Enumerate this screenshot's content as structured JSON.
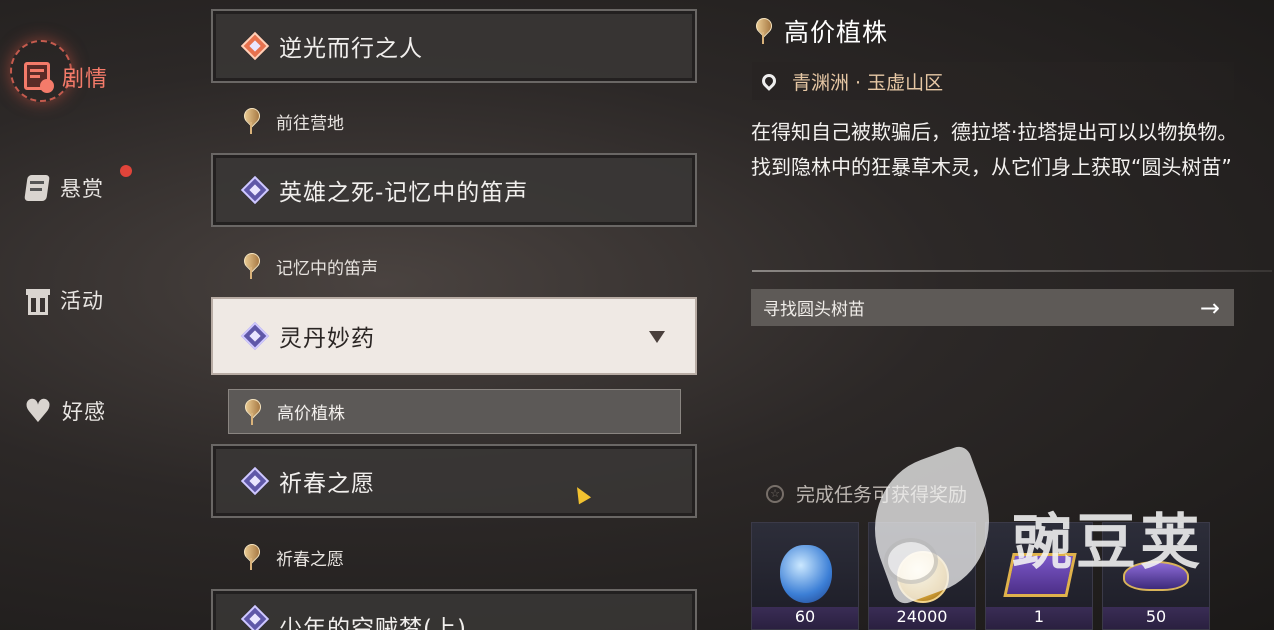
{
  "nav": [
    {
      "label": "剧情",
      "icon": "scroll-play-icon",
      "active": true
    },
    {
      "label": "悬赏",
      "icon": "bounty-scroll-icon",
      "badge": true
    },
    {
      "label": "活动",
      "icon": "gift-icon"
    },
    {
      "label": "好感",
      "icon": "heart-icon"
    }
  ],
  "quests": {
    "q1": {
      "title": "逆光而行之人",
      "sub": "前往营地"
    },
    "q2": {
      "title": "英雄之死-记忆中的笛声",
      "sub": "记忆中的笛声"
    },
    "q3": {
      "title": "灵丹妙药",
      "sub": "高价植株"
    },
    "q4": {
      "title": "祈春之愿",
      "sub": "祈春之愿"
    },
    "q5": {
      "title": "少年的空贼梦(上)"
    }
  },
  "detail": {
    "title": "高价植株",
    "location": "青渊洲 · 玉虚山区",
    "description": "在得知自己被欺骗后，德拉塔·拉塔提出可以以物换物。找到隐林中的狂暴草木灵，从它们身上获取“圆头树苗”",
    "objective": "寻找圆头树苗",
    "reward_header": "完成任务可获得奖励",
    "rewards": [
      {
        "icon": "blue-potion-icon",
        "count": "60"
      },
      {
        "icon": "gold-coin-icon",
        "count": "24000"
      },
      {
        "icon": "treasure-chest-icon",
        "count": "1"
      },
      {
        "icon": "magic-lamp-icon",
        "count": "50"
      }
    ]
  },
  "watermark": "豌豆荚",
  "colors": {
    "active": "#f47b6a",
    "badge": "#e0443a"
  }
}
